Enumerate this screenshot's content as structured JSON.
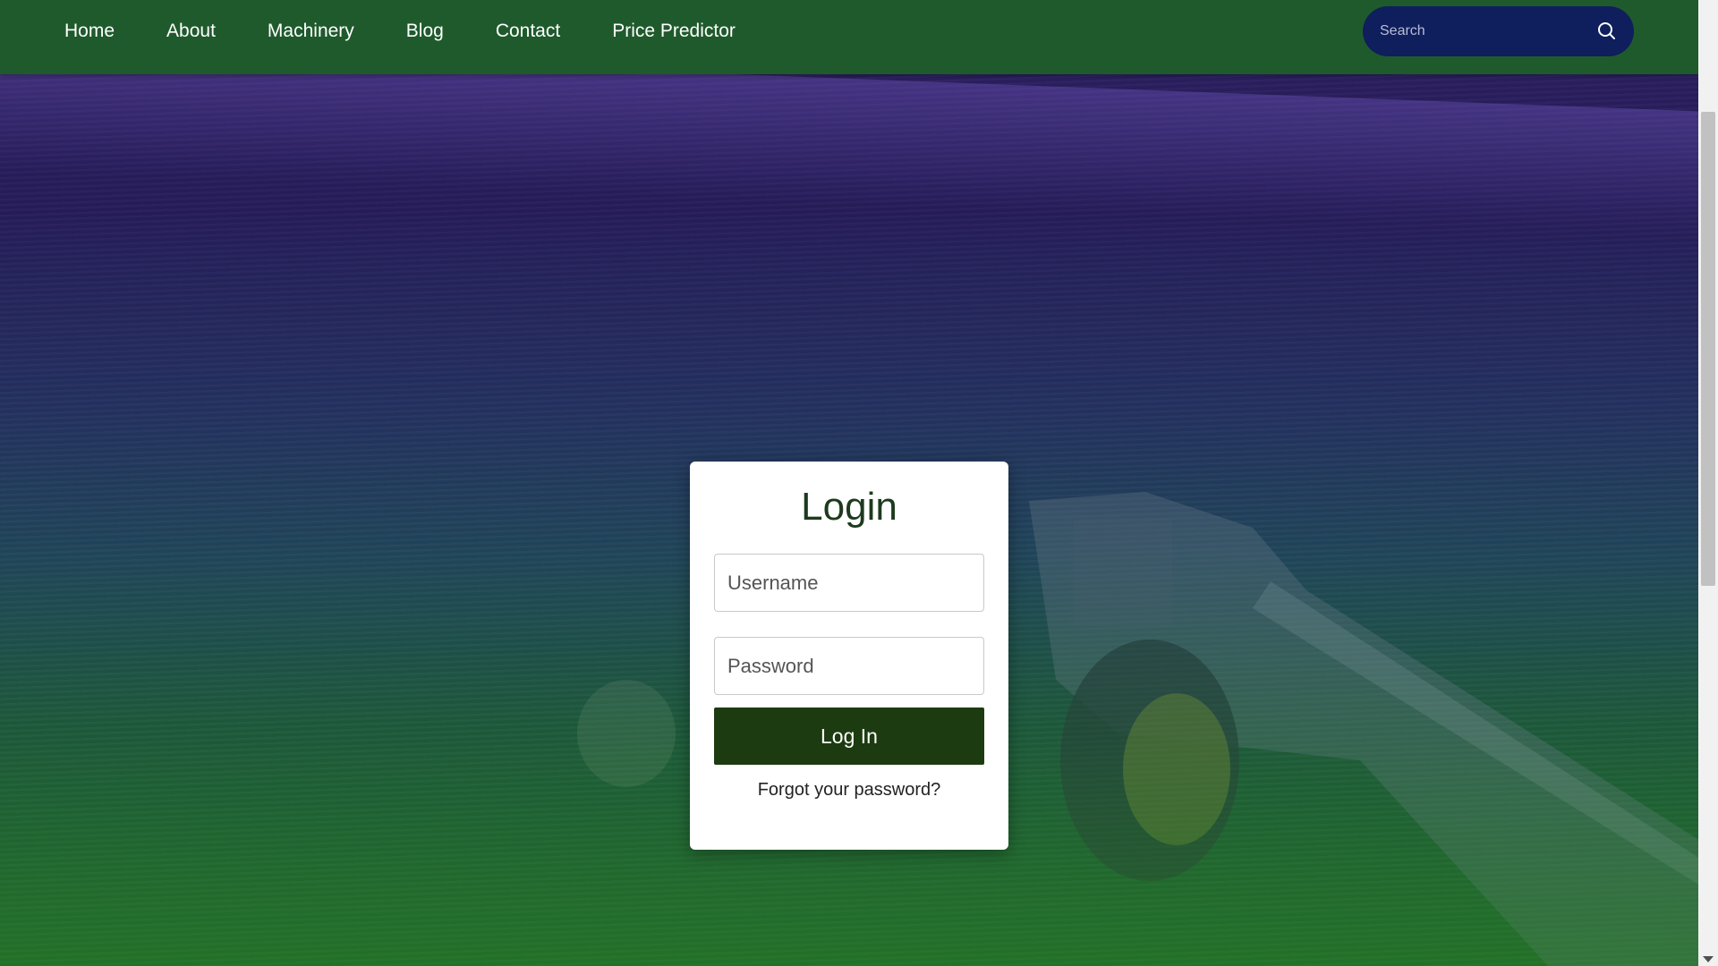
{
  "nav": {
    "items": [
      {
        "label": "Home"
      },
      {
        "label": "About"
      },
      {
        "label": "Machinery"
      },
      {
        "label": "Blog"
      },
      {
        "label": "Contact"
      },
      {
        "label": "Price Predictor"
      }
    ],
    "search_placeholder": "Search",
    "search_icon": "search-icon"
  },
  "login": {
    "title": "Login",
    "username_placeholder": "Username",
    "password_placeholder": "Password",
    "submit_label": "Log In",
    "forgot_label": "Forgot your password?"
  },
  "colors": {
    "navbar": "#1f5a2c",
    "search_bg": "#0f1e5c",
    "button": "#1d3b10",
    "title": "#1e3a1e"
  }
}
